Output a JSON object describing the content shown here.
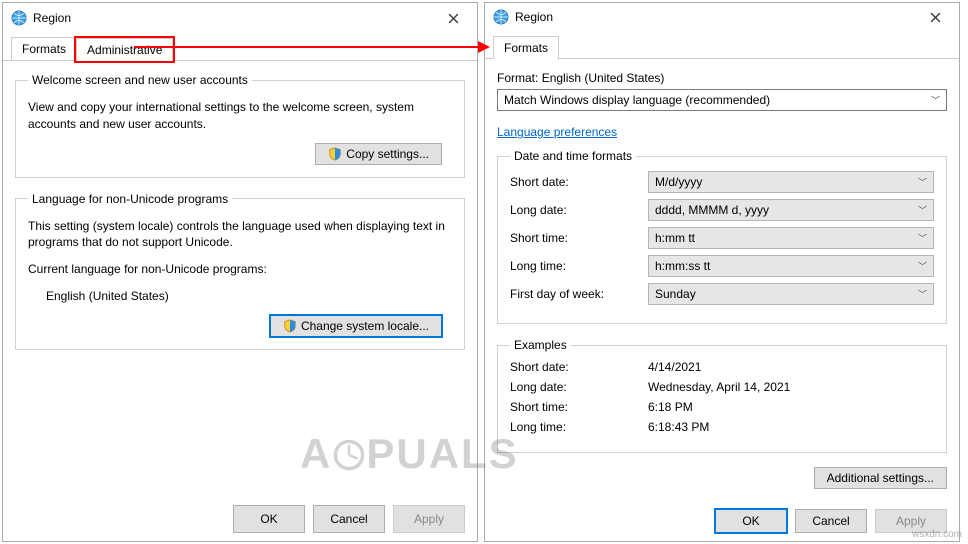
{
  "left_window": {
    "title": "Region",
    "tabs": {
      "formats": "Formats",
      "administrative": "Administrative"
    },
    "group1": {
      "legend": "Welcome screen and new user accounts",
      "text": "View and copy your international settings to the welcome screen, system accounts and new user accounts.",
      "button": "Copy settings..."
    },
    "group2": {
      "legend": "Language for non-Unicode programs",
      "text": "This setting (system locale) controls the language used when displaying text in programs that do not support Unicode.",
      "current_label": "Current language for non-Unicode programs:",
      "current_value": "English (United States)",
      "button": "Change system locale..."
    },
    "footer": {
      "ok": "OK",
      "cancel": "Cancel",
      "apply": "Apply"
    }
  },
  "right_window": {
    "title": "Region",
    "tabs": {
      "formats": "Formats"
    },
    "format_label": "Format:",
    "format_value": "English (United States)",
    "format_select": "Match Windows display language (recommended)",
    "lang_pref_link": "Language preferences",
    "dt_group": {
      "legend": "Date and time formats",
      "rows": {
        "short_date_label": "Short date:",
        "short_date_value": "M/d/yyyy",
        "long_date_label": "Long date:",
        "long_date_value": "dddd, MMMM d, yyyy",
        "short_time_label": "Short time:",
        "short_time_value": "h:mm tt",
        "long_time_label": "Long time:",
        "long_time_value": "h:mm:ss tt",
        "first_day_label": "First day of week:",
        "first_day_value": "Sunday"
      }
    },
    "ex_group": {
      "legend": "Examples",
      "rows": {
        "short_date_label": "Short date:",
        "short_date_value": "4/14/2021",
        "long_date_label": "Long date:",
        "long_date_value": "Wednesday, April 14, 2021",
        "short_time_label": "Short time:",
        "short_time_value": "6:18 PM",
        "long_time_label": "Long time:",
        "long_time_value": "6:18:43 PM"
      }
    },
    "additional_btn": "Additional settings...",
    "footer": {
      "ok": "OK",
      "cancel": "Cancel",
      "apply": "Apply"
    }
  },
  "watermark": "APPUALS",
  "credit": "wsxdn.com"
}
